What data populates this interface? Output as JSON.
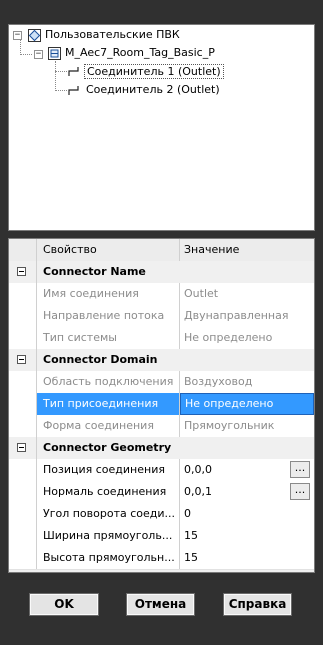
{
  "tree": {
    "root": {
      "label": "Пользовательские ПВК"
    },
    "family": {
      "label": "M_Aec7_Room_Tag_Basic_P"
    },
    "connectors": [
      {
        "label": "Соединитель 1 (Outlet)"
      },
      {
        "label": "Соединитель 2 (Outlet)"
      }
    ]
  },
  "grid": {
    "headers": {
      "property": "Свойство",
      "value": "Значение"
    },
    "rows": [
      {
        "type": "cat",
        "name": "Connector Name"
      },
      {
        "type": "dis",
        "name": "Имя соединения",
        "value": "Outlet"
      },
      {
        "type": "dis",
        "name": "Направление потока",
        "value": "Двунаправленная"
      },
      {
        "type": "dis",
        "name": "Тип системы",
        "value": "Не определено"
      },
      {
        "type": "cat",
        "name": "Connector Domain"
      },
      {
        "type": "dis",
        "name": "Область подключения",
        "value": "Воздуховод"
      },
      {
        "type": "sel",
        "name": "Тип присоединения",
        "value": "Не определено"
      },
      {
        "type": "dis",
        "name": "Форма соединения",
        "value": "Прямоугольник"
      },
      {
        "type": "cat",
        "name": "Connector Geometry"
      },
      {
        "type": "ed",
        "name": "Позиция соединения",
        "value": "0,0,0",
        "ellipsis": "..."
      },
      {
        "type": "ed",
        "name": "Нормаль соединения",
        "value": "0,0,1",
        "ellipsis": "..."
      },
      {
        "type": "ed",
        "name": "Угол поворота соеди...",
        "value": "0"
      },
      {
        "type": "ed",
        "name": "Ширина прямоуголь...",
        "value": "15"
      },
      {
        "type": "ed",
        "name": "Высота прямоугольн...",
        "value": "15"
      }
    ]
  },
  "buttons": {
    "ok": "OK",
    "cancel": "Отмена",
    "help": "Справка"
  }
}
